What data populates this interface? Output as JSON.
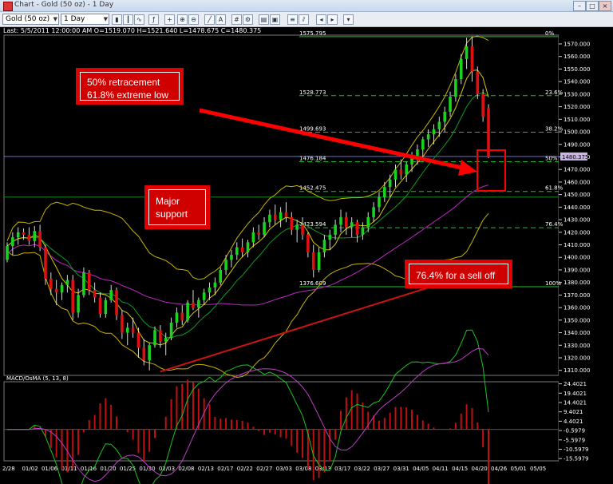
{
  "window": {
    "title": "Chart - Gold (50 oz) - 1 Day"
  },
  "toolbar": {
    "symbol": "Gold (50 oz)",
    "interval": "1 Day"
  },
  "info_line": "Last: 5/5/2011 12:00:00 AM O=1519.070 H=1521.640 L=1478.675 C=1480.375",
  "macd_label": "MACD/OsMA (5, 13, 8)",
  "price_tag": "1480.375",
  "annotations": {
    "retracement": [
      "50% retracement",
      "61.8% extreme low"
    ],
    "support": [
      "Major",
      "support"
    ],
    "selloff": "76.4% for a sell off"
  },
  "chart_data": [
    {
      "type": "candlestick",
      "ylim": [
        1306,
        1577
      ],
      "y_ticks": [
        1310,
        1320,
        1330,
        1340,
        1350,
        1360,
        1370,
        1380,
        1390,
        1400,
        1410,
        1420,
        1430,
        1440,
        1450,
        1460,
        1470,
        1480,
        1490,
        1500,
        1510,
        1520,
        1530,
        1540,
        1550,
        1560,
        1570
      ],
      "x_ticks": [
        "2/28",
        "01/02",
        "01/06",
        "01/11",
        "01/16",
        "01/20",
        "01/25",
        "01/30",
        "02/03",
        "02/08",
        "02/13",
        "02/17",
        "02/22",
        "02/27",
        "03/03",
        "03/08",
        "03/13",
        "03/17",
        "03/22",
        "03/27",
        "03/31",
        "04/05",
        "04/11",
        "04/15",
        "04/20",
        "04/26",
        "05/01",
        "05/05"
      ],
      "fib_levels": [
        {
          "pct": "0%",
          "price_label": "1575.795",
          "price": 1575.8
        },
        {
          "pct": "23.6%",
          "price_label": "1528.773",
          "price": 1528.8
        },
        {
          "pct": "38.2%",
          "price_label": "1499.693",
          "price": 1499.7
        },
        {
          "pct": "50%",
          "price_label": "1476.184",
          "price": 1476.2
        },
        {
          "pct": "61.8%",
          "price_label": "1452.475",
          "price": 1452.5
        },
        {
          "pct": "76.4%",
          "price_label": "1423.594",
          "price": 1423.6
        },
        {
          "pct": "100%",
          "price_label": "1376.609",
          "price": 1376.6
        }
      ],
      "support_line": 1448,
      "last_price": 1480.375,
      "ohlc": [
        [
          1398,
          1412,
          1396,
          1409
        ],
        [
          1409,
          1420,
          1402,
          1416
        ],
        [
          1416,
          1424,
          1410,
          1420
        ],
        [
          1420,
          1423,
          1414,
          1418
        ],
        [
          1418,
          1424,
          1410,
          1413
        ],
        [
          1413,
          1425,
          1408,
          1421
        ],
        [
          1421,
          1426,
          1405,
          1408
        ],
        [
          1408,
          1410,
          1378,
          1383
        ],
        [
          1383,
          1388,
          1370,
          1375
        ],
        [
          1375,
          1382,
          1362,
          1372
        ],
        [
          1372,
          1380,
          1366,
          1378
        ],
        [
          1378,
          1386,
          1372,
          1382
        ],
        [
          1382,
          1386,
          1350,
          1356
        ],
        [
          1356,
          1375,
          1352,
          1370
        ],
        [
          1370,
          1392,
          1368,
          1388
        ],
        [
          1388,
          1390,
          1370,
          1374
        ],
        [
          1374,
          1380,
          1364,
          1368
        ],
        [
          1368,
          1372,
          1352,
          1355
        ],
        [
          1355,
          1368,
          1352,
          1366
        ],
        [
          1366,
          1378,
          1364,
          1374
        ],
        [
          1374,
          1376,
          1350,
          1354
        ],
        [
          1354,
          1358,
          1335,
          1340
        ],
        [
          1340,
          1348,
          1330,
          1344
        ],
        [
          1344,
          1352,
          1336,
          1340
        ],
        [
          1340,
          1344,
          1320,
          1328
        ],
        [
          1328,
          1335,
          1314,
          1318
        ],
        [
          1318,
          1332,
          1310,
          1330
        ],
        [
          1330,
          1345,
          1328,
          1342
        ],
        [
          1342,
          1346,
          1328,
          1333
        ],
        [
          1333,
          1340,
          1322,
          1336
        ],
        [
          1336,
          1352,
          1334,
          1348
        ],
        [
          1348,
          1360,
          1344,
          1356
        ],
        [
          1356,
          1362,
          1346,
          1350
        ],
        [
          1350,
          1366,
          1348,
          1364
        ],
        [
          1364,
          1374,
          1358,
          1360
        ],
        [
          1360,
          1368,
          1352,
          1366
        ],
        [
          1366,
          1375,
          1362,
          1372
        ],
        [
          1372,
          1380,
          1366,
          1376
        ],
        [
          1376,
          1384,
          1370,
          1380
        ],
        [
          1380,
          1392,
          1378,
          1390
        ],
        [
          1390,
          1402,
          1386,
          1398
        ],
        [
          1398,
          1406,
          1392,
          1402
        ],
        [
          1402,
          1412,
          1398,
          1408
        ],
        [
          1408,
          1415,
          1400,
          1404
        ],
        [
          1404,
          1414,
          1400,
          1412
        ],
        [
          1412,
          1424,
          1408,
          1420
        ],
        [
          1420,
          1426,
          1414,
          1418
        ],
        [
          1418,
          1432,
          1416,
          1428
        ],
        [
          1428,
          1438,
          1424,
          1434
        ],
        [
          1434,
          1442,
          1426,
          1430
        ],
        [
          1430,
          1440,
          1424,
          1436
        ],
        [
          1436,
          1444,
          1428,
          1432
        ],
        [
          1432,
          1436,
          1418,
          1422
        ],
        [
          1422,
          1430,
          1412,
          1426
        ],
        [
          1426,
          1432,
          1414,
          1418
        ],
        [
          1418,
          1420,
          1400,
          1404
        ],
        [
          1404,
          1410,
          1384,
          1390
        ],
        [
          1390,
          1408,
          1388,
          1404
        ],
        [
          1404,
          1418,
          1400,
          1414
        ],
        [
          1414,
          1422,
          1406,
          1418
        ],
        [
          1418,
          1430,
          1414,
          1426
        ],
        [
          1426,
          1438,
          1420,
          1432
        ],
        [
          1432,
          1436,
          1418,
          1424
        ],
        [
          1424,
          1432,
          1416,
          1428
        ],
        [
          1428,
          1430,
          1412,
          1418
        ],
        [
          1418,
          1428,
          1414,
          1424
        ],
        [
          1424,
          1436,
          1420,
          1432
        ],
        [
          1432,
          1444,
          1428,
          1440
        ],
        [
          1440,
          1452,
          1436,
          1448
        ],
        [
          1448,
          1460,
          1444,
          1456
        ],
        [
          1456,
          1466,
          1448,
          1462
        ],
        [
          1462,
          1474,
          1456,
          1470
        ],
        [
          1470,
          1478,
          1462,
          1466
        ],
        [
          1466,
          1476,
          1460,
          1474
        ],
        [
          1474,
          1484,
          1468,
          1480
        ],
        [
          1480,
          1490,
          1474,
          1486
        ],
        [
          1486,
          1496,
          1480,
          1494
        ],
        [
          1494,
          1502,
          1488,
          1498
        ],
        [
          1498,
          1506,
          1490,
          1502
        ],
        [
          1502,
          1512,
          1496,
          1508
        ],
        [
          1508,
          1520,
          1500,
          1516
        ],
        [
          1516,
          1532,
          1512,
          1528
        ],
        [
          1528,
          1546,
          1524,
          1542
        ],
        [
          1542,
          1562,
          1538,
          1558
        ],
        [
          1558,
          1575,
          1550,
          1568
        ],
        [
          1568,
          1576,
          1540,
          1548
        ],
        [
          1548,
          1552,
          1526,
          1530
        ],
        [
          1530,
          1534,
          1508,
          1512
        ],
        [
          1519,
          1522,
          1479,
          1480
        ]
      ]
    },
    {
      "type": "line",
      "title": "MACD/OsMA (5, 13, 8)",
      "ylim": [
        -16.8,
        25.5
      ],
      "y_ticks": [
        24.4021,
        19.4021,
        14.4021,
        9.4021,
        4.4021,
        -0.5979,
        -5.5979,
        -10.5979,
        -15.5979
      ]
    }
  ]
}
